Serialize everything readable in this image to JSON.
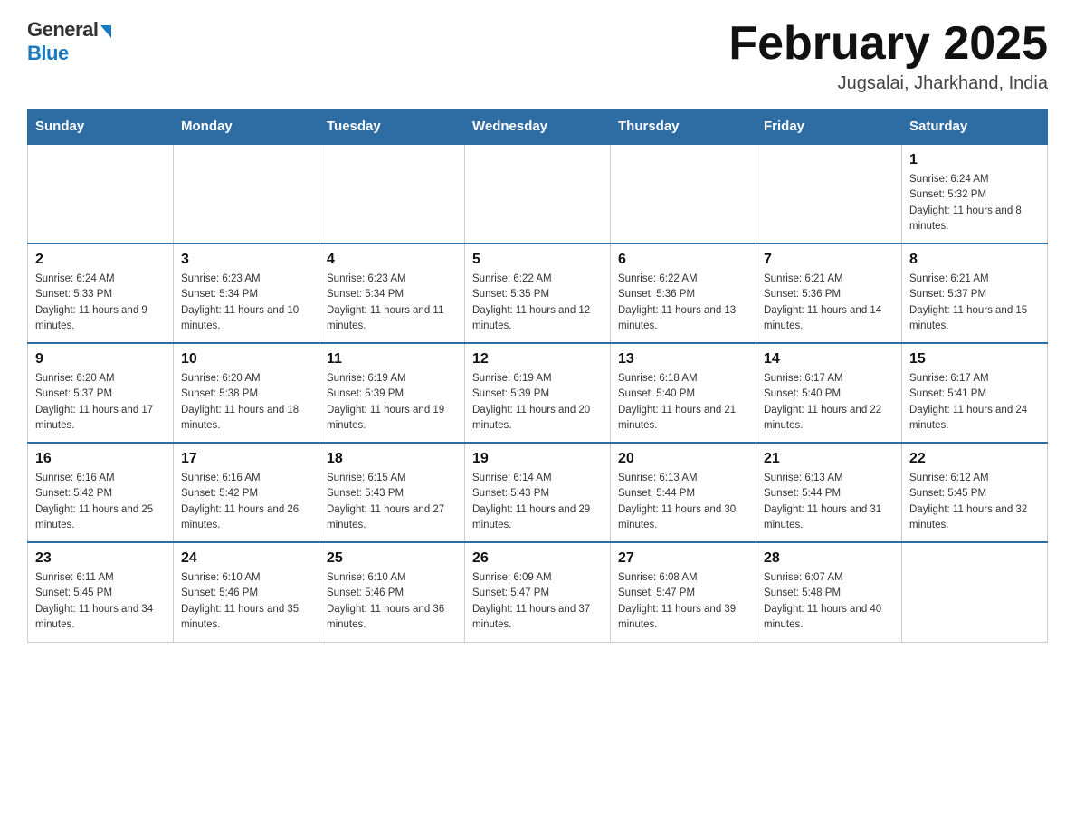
{
  "header": {
    "logo_general": "General",
    "logo_blue": "Blue",
    "title": "February 2025",
    "location": "Jugsalai, Jharkhand, India"
  },
  "days_of_week": [
    "Sunday",
    "Monday",
    "Tuesday",
    "Wednesday",
    "Thursday",
    "Friday",
    "Saturday"
  ],
  "weeks": [
    [
      {
        "day": "",
        "info": ""
      },
      {
        "day": "",
        "info": ""
      },
      {
        "day": "",
        "info": ""
      },
      {
        "day": "",
        "info": ""
      },
      {
        "day": "",
        "info": ""
      },
      {
        "day": "",
        "info": ""
      },
      {
        "day": "1",
        "info": "Sunrise: 6:24 AM\nSunset: 5:32 PM\nDaylight: 11 hours and 8 minutes."
      }
    ],
    [
      {
        "day": "2",
        "info": "Sunrise: 6:24 AM\nSunset: 5:33 PM\nDaylight: 11 hours and 9 minutes."
      },
      {
        "day": "3",
        "info": "Sunrise: 6:23 AM\nSunset: 5:34 PM\nDaylight: 11 hours and 10 minutes."
      },
      {
        "day": "4",
        "info": "Sunrise: 6:23 AM\nSunset: 5:34 PM\nDaylight: 11 hours and 11 minutes."
      },
      {
        "day": "5",
        "info": "Sunrise: 6:22 AM\nSunset: 5:35 PM\nDaylight: 11 hours and 12 minutes."
      },
      {
        "day": "6",
        "info": "Sunrise: 6:22 AM\nSunset: 5:36 PM\nDaylight: 11 hours and 13 minutes."
      },
      {
        "day": "7",
        "info": "Sunrise: 6:21 AM\nSunset: 5:36 PM\nDaylight: 11 hours and 14 minutes."
      },
      {
        "day": "8",
        "info": "Sunrise: 6:21 AM\nSunset: 5:37 PM\nDaylight: 11 hours and 15 minutes."
      }
    ],
    [
      {
        "day": "9",
        "info": "Sunrise: 6:20 AM\nSunset: 5:37 PM\nDaylight: 11 hours and 17 minutes."
      },
      {
        "day": "10",
        "info": "Sunrise: 6:20 AM\nSunset: 5:38 PM\nDaylight: 11 hours and 18 minutes."
      },
      {
        "day": "11",
        "info": "Sunrise: 6:19 AM\nSunset: 5:39 PM\nDaylight: 11 hours and 19 minutes."
      },
      {
        "day": "12",
        "info": "Sunrise: 6:19 AM\nSunset: 5:39 PM\nDaylight: 11 hours and 20 minutes."
      },
      {
        "day": "13",
        "info": "Sunrise: 6:18 AM\nSunset: 5:40 PM\nDaylight: 11 hours and 21 minutes."
      },
      {
        "day": "14",
        "info": "Sunrise: 6:17 AM\nSunset: 5:40 PM\nDaylight: 11 hours and 22 minutes."
      },
      {
        "day": "15",
        "info": "Sunrise: 6:17 AM\nSunset: 5:41 PM\nDaylight: 11 hours and 24 minutes."
      }
    ],
    [
      {
        "day": "16",
        "info": "Sunrise: 6:16 AM\nSunset: 5:42 PM\nDaylight: 11 hours and 25 minutes."
      },
      {
        "day": "17",
        "info": "Sunrise: 6:16 AM\nSunset: 5:42 PM\nDaylight: 11 hours and 26 minutes."
      },
      {
        "day": "18",
        "info": "Sunrise: 6:15 AM\nSunset: 5:43 PM\nDaylight: 11 hours and 27 minutes."
      },
      {
        "day": "19",
        "info": "Sunrise: 6:14 AM\nSunset: 5:43 PM\nDaylight: 11 hours and 29 minutes."
      },
      {
        "day": "20",
        "info": "Sunrise: 6:13 AM\nSunset: 5:44 PM\nDaylight: 11 hours and 30 minutes."
      },
      {
        "day": "21",
        "info": "Sunrise: 6:13 AM\nSunset: 5:44 PM\nDaylight: 11 hours and 31 minutes."
      },
      {
        "day": "22",
        "info": "Sunrise: 6:12 AM\nSunset: 5:45 PM\nDaylight: 11 hours and 32 minutes."
      }
    ],
    [
      {
        "day": "23",
        "info": "Sunrise: 6:11 AM\nSunset: 5:45 PM\nDaylight: 11 hours and 34 minutes."
      },
      {
        "day": "24",
        "info": "Sunrise: 6:10 AM\nSunset: 5:46 PM\nDaylight: 11 hours and 35 minutes."
      },
      {
        "day": "25",
        "info": "Sunrise: 6:10 AM\nSunset: 5:46 PM\nDaylight: 11 hours and 36 minutes."
      },
      {
        "day": "26",
        "info": "Sunrise: 6:09 AM\nSunset: 5:47 PM\nDaylight: 11 hours and 37 minutes."
      },
      {
        "day": "27",
        "info": "Sunrise: 6:08 AM\nSunset: 5:47 PM\nDaylight: 11 hours and 39 minutes."
      },
      {
        "day": "28",
        "info": "Sunrise: 6:07 AM\nSunset: 5:48 PM\nDaylight: 11 hours and 40 minutes."
      },
      {
        "day": "",
        "info": ""
      }
    ]
  ]
}
